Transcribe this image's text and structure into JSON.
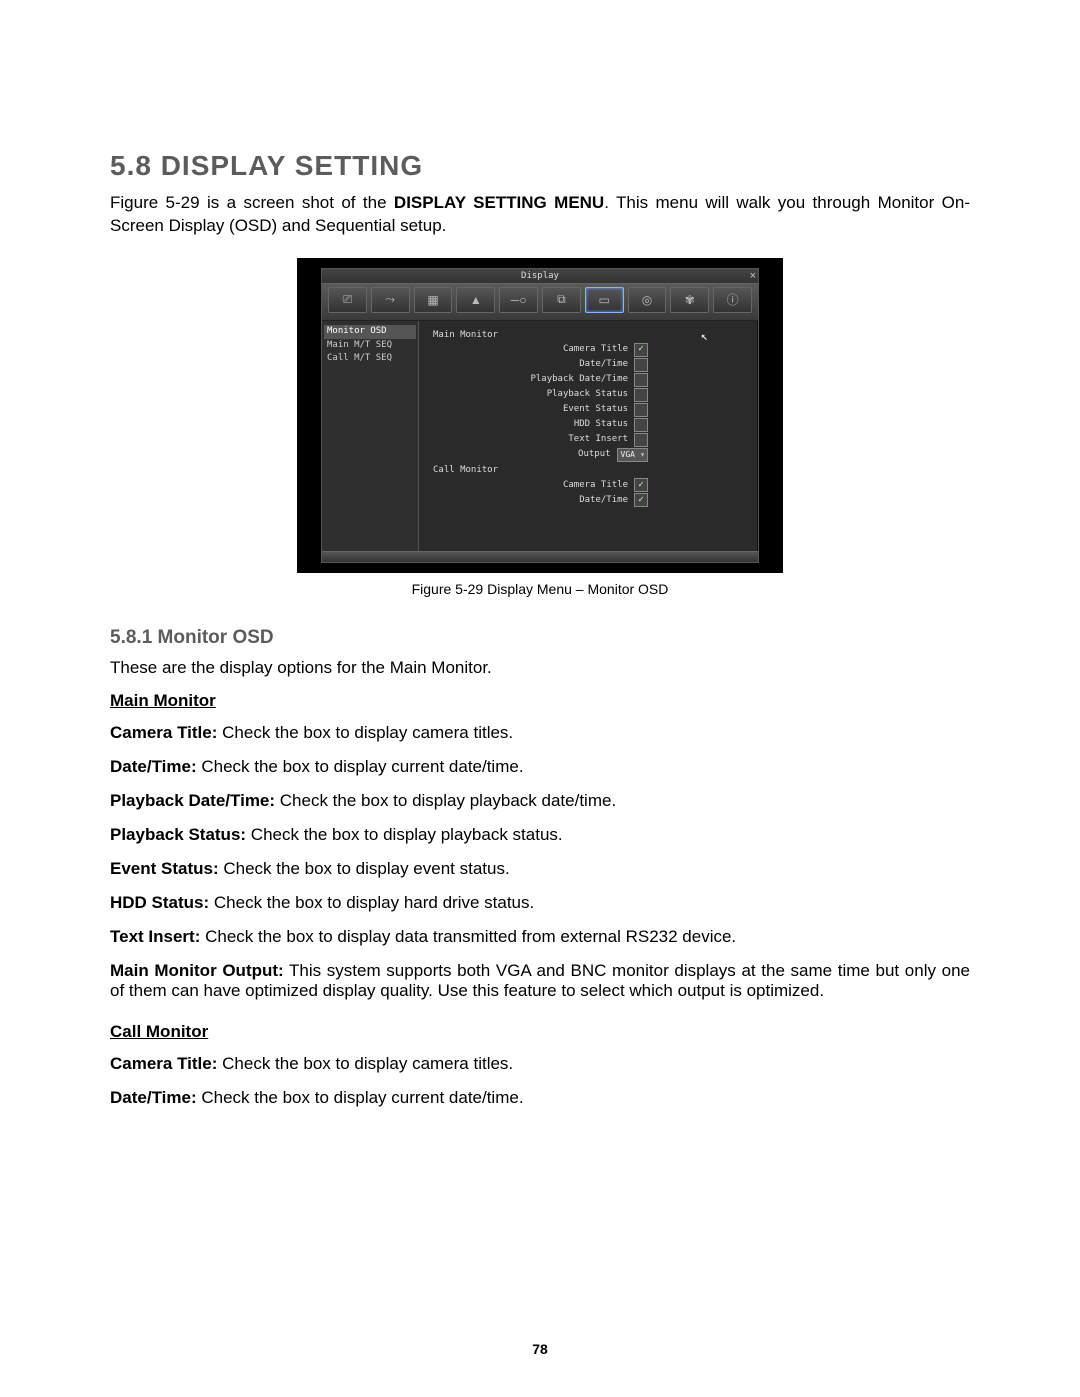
{
  "heading": "5.8 DISPLAY SETTING",
  "intro_pre": "Figure 5-29 is a screen shot of the ",
  "intro_bold": "DISPLAY SETTING MENU",
  "intro_post": ". This menu will walk you through Monitor On-Screen Display (OSD) and Sequential setup.",
  "caption": "Figure 5-29 Display Menu – Monitor OSD",
  "shot": {
    "title": "Display",
    "close": "×",
    "toolbar": [
      "⎚",
      "⤳",
      "▦",
      "▲",
      "─○",
      "⧉",
      "▭",
      "◎",
      "✾",
      "ⓘ"
    ],
    "active_idx": 6,
    "sidebar": [
      "Monitor OSD",
      "Main M/T SEQ",
      "Call M/T SEQ"
    ],
    "sidebar_sel": 0,
    "main_monitor_label": "Main Monitor",
    "call_monitor_label": "Call Monitor",
    "rows_main": [
      {
        "label": "Camera Title",
        "checked": true
      },
      {
        "label": "Date/Time",
        "checked": false
      },
      {
        "label": "Playback Date/Time",
        "checked": false
      },
      {
        "label": "Playback Status",
        "checked": false
      },
      {
        "label": "Event Status",
        "checked": false
      },
      {
        "label": "HDD Status",
        "checked": false
      },
      {
        "label": "Text Insert",
        "checked": false
      }
    ],
    "output_label": "Output",
    "output_value": "VGA",
    "rows_call": [
      {
        "label": "Camera Title",
        "checked": true
      },
      {
        "label": "Date/Time",
        "checked": true
      }
    ]
  },
  "sub_heading": "5.8.1   Monitor OSD",
  "sub_intro": "These are the display options for the Main Monitor.",
  "main_mon_head": "Main Monitor",
  "defs_main": [
    {
      "k": "Camera Title:",
      "v": " Check the box to display camera titles."
    },
    {
      "k": "Date/Time:",
      "v": " Check the box to display current date/time."
    },
    {
      "k": "Playback Date/Time:",
      "v": " Check the box to display playback date/time."
    },
    {
      "k": "Playback Status:",
      "v": " Check the box to display playback status."
    },
    {
      "k": "Event Status:",
      "v": " Check the box to display event status."
    },
    {
      "k": "HDD Status:",
      "v": " Check the box to display hard drive status."
    },
    {
      "k": "Text Insert:",
      "v": " Check the box to display data transmitted from external RS232 device."
    },
    {
      "k": "Main Monitor Output:",
      "v": "  This system supports both VGA and BNC monitor displays at the same time but only one of them can have optimized display quality. Use this feature to select which output is optimized."
    }
  ],
  "call_mon_head": "Call Monitor",
  "defs_call": [
    {
      "k": "Camera Title:",
      "v": " Check the box to display camera titles."
    },
    {
      "k": "Date/Time:",
      "v": " Check the box to display current date/time."
    }
  ],
  "pageno": "78"
}
